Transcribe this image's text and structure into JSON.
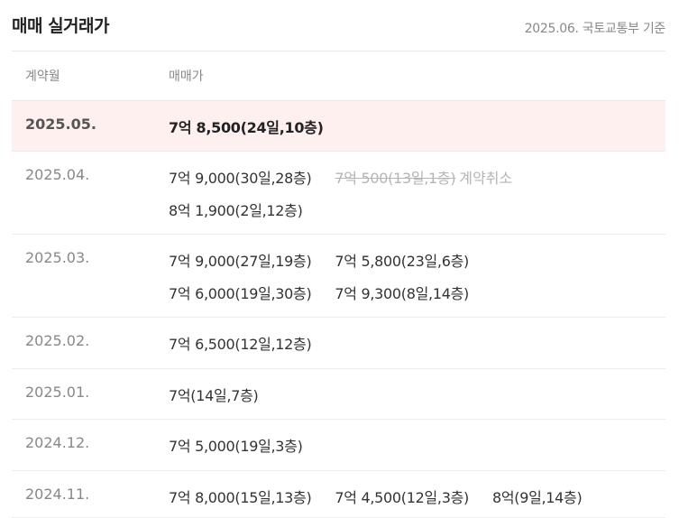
{
  "header": {
    "title": "매매 실거래가",
    "basis": "2025.06. 국토교통부 기준"
  },
  "columns": {
    "month": "계약월",
    "price": "매매가"
  },
  "rows": [
    {
      "month": "2025.05.",
      "highlight": true,
      "lines": [
        [
          {
            "text": "7억 8,500(24일,10층)",
            "bold": true
          }
        ]
      ]
    },
    {
      "month": "2025.04.",
      "lines": [
        [
          {
            "text": "7억 9,000(30일,28층)"
          },
          {
            "text": "7억 500(13일,1층)",
            "cancelled": true,
            "tag": "계약취소"
          }
        ],
        [
          {
            "text": "8억 1,900(2일,12층)"
          }
        ]
      ]
    },
    {
      "month": "2025.03.",
      "lines": [
        [
          {
            "text": "7억 9,000(27일,19층)"
          },
          {
            "text": "7억 5,800(23일,6층)"
          }
        ],
        [
          {
            "text": "7억 6,000(19일,30층)"
          },
          {
            "text": "7억 9,300(8일,14층)"
          }
        ]
      ]
    },
    {
      "month": "2025.02.",
      "lines": [
        [
          {
            "text": "7억 6,500(12일,12층)"
          }
        ]
      ]
    },
    {
      "month": "2025.01.",
      "lines": [
        [
          {
            "text": "7억(14일,7층)"
          }
        ]
      ]
    },
    {
      "month": "2024.12.",
      "lines": [
        [
          {
            "text": "7억 5,000(19일,3층)"
          }
        ]
      ]
    },
    {
      "month": "2024.11.",
      "lines": [
        [
          {
            "text": "7억 8,000(15일,13층)"
          },
          {
            "text": "7억 4,500(12일,3층)"
          },
          {
            "text": "8억(9일,14층)"
          }
        ]
      ]
    }
  ]
}
